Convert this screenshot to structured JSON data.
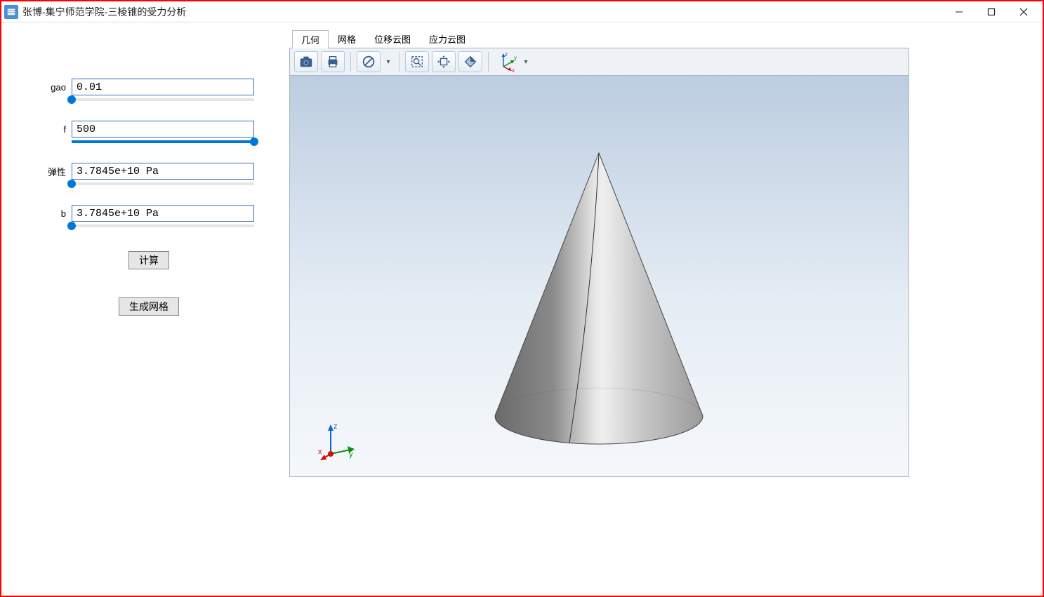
{
  "window": {
    "title": "张博-集宁师范学院-三棱锥的受力分析"
  },
  "params": {
    "gao": {
      "label": "gao",
      "value": "0.01",
      "slider_pct": 0
    },
    "f": {
      "label": "f",
      "value": "500",
      "slider_pct": 100
    },
    "tan": {
      "label": "弹性",
      "value": "3.7845e+10 Pa",
      "slider_pct": 0
    },
    "b": {
      "label": "b",
      "value": "3.7845e+10 Pa",
      "slider_pct": 0
    }
  },
  "buttons": {
    "compute": "计算",
    "genmesh": "生成网格"
  },
  "tabs": [
    "几何",
    "网格",
    "位移云图",
    "应力云图"
  ],
  "active_tab": 0,
  "axis": {
    "x": "x",
    "y": "y",
    "z": "z"
  }
}
